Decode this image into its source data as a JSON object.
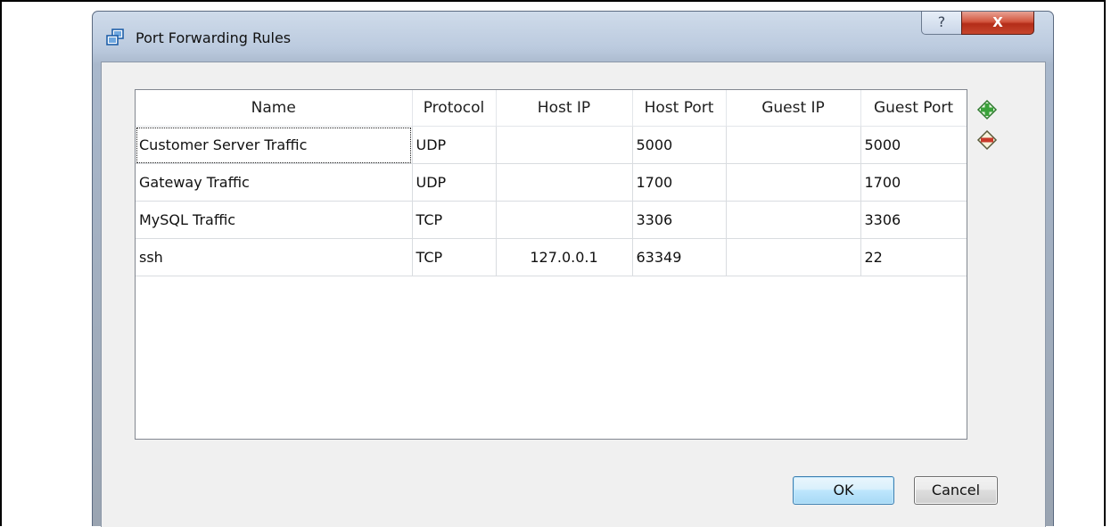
{
  "window": {
    "title": "Port Forwarding Rules",
    "help_glyph": "?",
    "close_glyph": "X"
  },
  "table": {
    "columns": [
      "Name",
      "Protocol",
      "Host IP",
      "Host Port",
      "Guest IP",
      "Guest Port"
    ],
    "rows": [
      {
        "name": "Customer Server Traffic",
        "protocol": "UDP",
        "host_ip": "",
        "host_port": "5000",
        "guest_ip": "",
        "guest_port": "5000"
      },
      {
        "name": "Gateway Traffic",
        "protocol": "UDP",
        "host_ip": "",
        "host_port": "1700",
        "guest_ip": "",
        "guest_port": "1700"
      },
      {
        "name": "MySQL Traffic",
        "protocol": "TCP",
        "host_ip": "",
        "host_port": "3306",
        "guest_ip": "",
        "guest_port": "3306"
      },
      {
        "name": "ssh",
        "protocol": "TCP",
        "host_ip": "127.0.0.1",
        "host_port": "63349",
        "guest_ip": "",
        "guest_port": "22"
      }
    ]
  },
  "side_buttons": {
    "add_icon": "add-rule-icon",
    "remove_icon": "remove-rule-icon"
  },
  "buttons": {
    "ok": "OK",
    "cancel": "Cancel"
  },
  "colors": {
    "close_button": "#c6452d",
    "add_icon": "#3aa23a",
    "remove_icon": "#c93a2a"
  }
}
